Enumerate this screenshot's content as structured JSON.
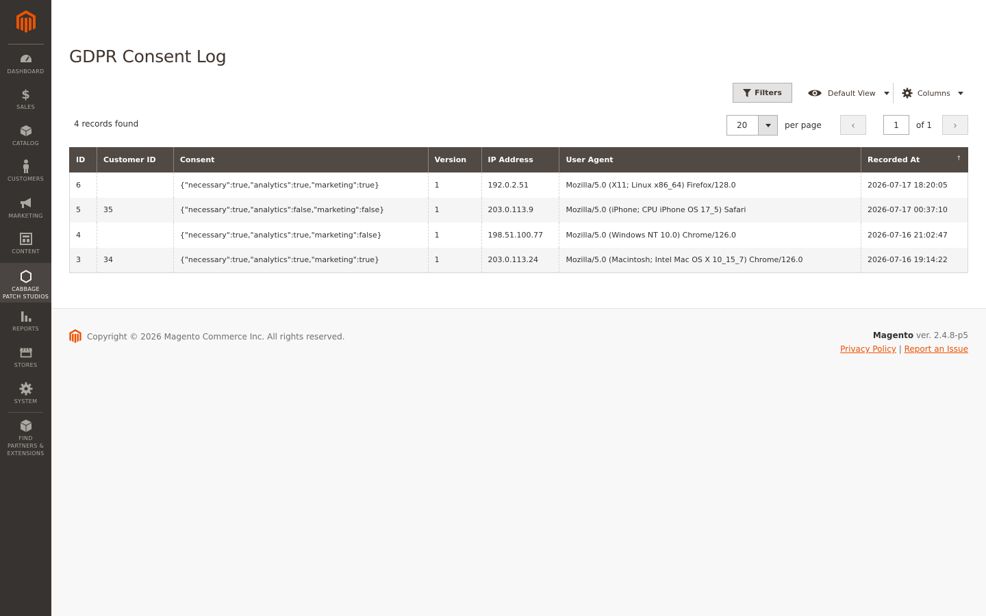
{
  "page": {
    "title": "GDPR Consent Log"
  },
  "sidebar": {
    "items": [
      {
        "label": "DASHBOARD",
        "icon": "dashboard-icon"
      },
      {
        "label": "SALES",
        "icon": "dollar-icon"
      },
      {
        "label": "CATALOG",
        "icon": "box-icon"
      },
      {
        "label": "CUSTOMERS",
        "icon": "person-icon"
      },
      {
        "label": "MARKETING",
        "icon": "megaphone-icon"
      },
      {
        "label": "CONTENT",
        "icon": "layout-icon"
      },
      {
        "label": "CABBAGE PATCH STUDIOS",
        "icon": "hexagon-icon",
        "active": true
      },
      {
        "label": "REPORTS",
        "icon": "bar-chart-icon"
      },
      {
        "label": "STORES",
        "icon": "storefront-icon"
      },
      {
        "label": "SYSTEM",
        "icon": "gear-icon"
      },
      {
        "label": "FIND PARTNERS & EXTENSIONS",
        "icon": "cubes-icon"
      }
    ]
  },
  "toolbar": {
    "filters_label": "Filters",
    "view_label": "Default View",
    "columns_label": "Columns"
  },
  "pager": {
    "records_found": "4 records found",
    "per_page_value": "20",
    "per_page_label": "per page",
    "current_page": "1",
    "of_label": "of 1"
  },
  "grid": {
    "columns": [
      "ID",
      "Customer ID",
      "Consent",
      "Version",
      "IP Address",
      "User Agent",
      "Recorded At"
    ],
    "rows": [
      [
        "6",
        "",
        "{\"necessary\":true,\"analytics\":true,\"marketing\":true}",
        "1",
        "192.0.2.51",
        "Mozilla/5.0 (X11; Linux x86_64) Firefox/128.0",
        "2026-07-17 18:20:05"
      ],
      [
        "5",
        "35",
        "{\"necessary\":true,\"analytics\":false,\"marketing\":false}",
        "1",
        "203.0.113.9",
        "Mozilla/5.0 (iPhone; CPU iPhone OS 17_5) Safari",
        "2026-07-17 00:37:10"
      ],
      [
        "4",
        "",
        "{\"necessary\":true,\"analytics\":true,\"marketing\":false}",
        "1",
        "198.51.100.77",
        "Mozilla/5.0 (Windows NT 10.0) Chrome/126.0",
        "2026-07-16 21:02:47"
      ],
      [
        "3",
        "34",
        "{\"necessary\":true,\"analytics\":true,\"marketing\":true}",
        "1",
        "203.0.113.24",
        "Mozilla/5.0 (Macintosh; Intel Mac OS X 10_15_7) Chrome/126.0",
        "2026-07-16 19:14:22"
      ]
    ],
    "sort_indicator": "↑"
  },
  "footer": {
    "copyright": "Copyright © 2026 Magento Commerce Inc. All rights reserved.",
    "brand": "Magento",
    "version": "ver. 2.4.8-p5",
    "privacy_link": "Privacy Policy",
    "separator": "|",
    "report_link": "Report an Issue"
  },
  "colors": {
    "accent": "#eb5202",
    "sidebar_bg": "#373330",
    "header_bg": "#514943"
  }
}
